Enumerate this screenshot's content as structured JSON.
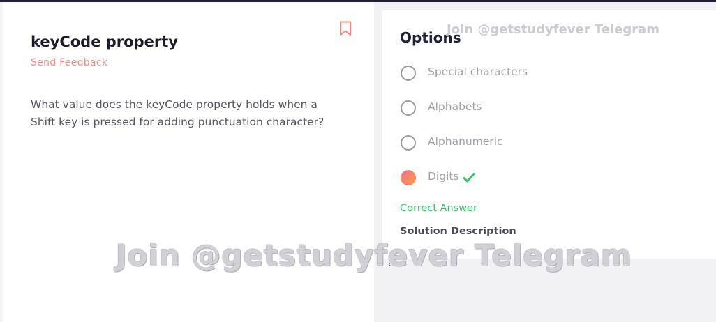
{
  "question": {
    "title": "keyCode property",
    "feedback_label": "Send Feedback",
    "text": "What value does the keyCode property holds when a Shift key is pressed for adding punctuation character?"
  },
  "options_panel": {
    "title": "Options",
    "options": [
      {
        "label": "Special characters",
        "selected": false
      },
      {
        "label": "Alphabets",
        "selected": false
      },
      {
        "label": "Alphanumeric",
        "selected": false
      },
      {
        "label": "Digits",
        "selected": true
      }
    ],
    "correct_answer_label": "Correct Answer",
    "solution_label": "Solution Description",
    "scroll_arrow": "‹"
  },
  "watermark": {
    "small": "Join @getstudyfever Telegram",
    "big": "Join @getstudyfever Telegram"
  },
  "icons": {
    "bookmark": "bookmark-icon",
    "check": "check-icon"
  },
  "colors": {
    "accent_feedback": "#f08a80",
    "correct_green": "#3bbf6a",
    "selected_gradient_start": "#f2708a",
    "selected_gradient_end": "#f7a04a"
  }
}
